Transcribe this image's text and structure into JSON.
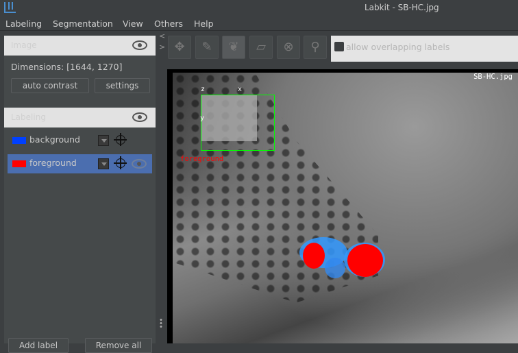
{
  "window": {
    "title": "Labkit - SB-HC.jpg"
  },
  "menu": [
    "Labeling",
    "Segmentation",
    "View",
    "Others",
    "Help"
  ],
  "image_panel": {
    "title": "Image",
    "dimensions": "Dimensions: [1644, 1270]",
    "auto_contrast": "auto contrast",
    "settings": "settings"
  },
  "labeling_panel": {
    "title": "Labeling",
    "labels": [
      {
        "name": "background",
        "color": "#0040ff",
        "selected": false,
        "visible": false
      },
      {
        "name": "foreground",
        "color": "#ff0000",
        "selected": true,
        "visible": true
      }
    ],
    "add_label": "Add label",
    "remove_all": "Remove all"
  },
  "toolbar": {
    "tools": [
      "move-icon",
      "pencil-icon",
      "flood-fill-icon",
      "eraser-icon",
      "flood-erase-icon",
      "eyedropper-icon"
    ],
    "allow_overlap": "allow overlapping labels",
    "allow_overlap_checked": false
  },
  "viewer": {
    "filename": "SB-HC.jpg",
    "axis_z": "z",
    "axis_x": "x",
    "axis_y": "y",
    "active_label": "foreground"
  },
  "colors": {
    "accent": "#4b6eaf",
    "box": "#00ff00"
  }
}
